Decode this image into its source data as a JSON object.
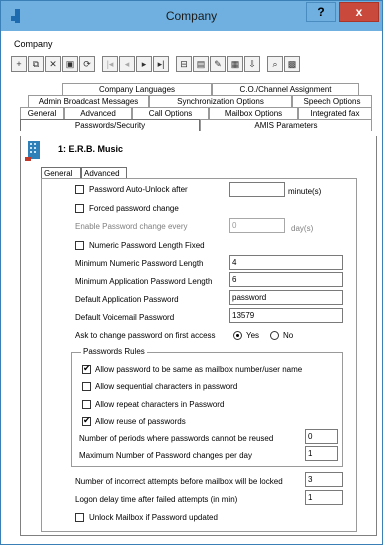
{
  "window": {
    "title": "Company",
    "help_label": "?",
    "close_label": "x"
  },
  "menu": {
    "items": [
      "Company"
    ]
  },
  "toolbar": {
    "buttons": [
      {
        "name": "add",
        "glyph": "+"
      },
      {
        "name": "copy",
        "glyph": "⧉"
      },
      {
        "name": "delete",
        "glyph": "✕"
      },
      {
        "name": "save",
        "glyph": "▣"
      },
      {
        "name": "refresh",
        "glyph": "⟳"
      },
      {
        "name": "first",
        "glyph": "|◂"
      },
      {
        "name": "prev",
        "glyph": "◂"
      },
      {
        "name": "next",
        "glyph": "▸"
      },
      {
        "name": "last",
        "glyph": "▸|"
      },
      {
        "name": "filter",
        "glyph": "⊟"
      },
      {
        "name": "view",
        "glyph": "▤"
      },
      {
        "name": "edit",
        "glyph": "✎"
      },
      {
        "name": "report",
        "glyph": "▦"
      },
      {
        "name": "export",
        "glyph": "⇩"
      },
      {
        "name": "find",
        "glyph": "⌕"
      },
      {
        "name": "print",
        "glyph": "▩"
      }
    ]
  },
  "tabs": {
    "row1": [
      "Company Languages",
      "C.O./Channel Assignment"
    ],
    "row2": [
      "Admin Broadcast Messages",
      "Synchronization Options",
      "Speech Options"
    ],
    "row3": [
      "General",
      "Advanced",
      "Call Options",
      "Mailbox Options",
      "Integrated fax"
    ],
    "row4": [
      "Passwords/Security",
      "AMIS Parameters"
    ]
  },
  "header": {
    "company": "1: E.R.B. Music"
  },
  "subtabs": [
    "General",
    "Advanced"
  ],
  "form": {
    "auto_unlock_label": "Password Auto-Unlock after",
    "auto_unlock_value": "",
    "auto_unlock_unit": "minute(s)",
    "forced_change_label": "Forced password change",
    "enable_change_every_label": "Enable Password change every",
    "enable_change_every_value": "0",
    "enable_change_every_unit": "day(s)",
    "numeric_fixed_label": "Numeric Password Length Fixed",
    "min_numeric_label": "Minimum Numeric Password Length",
    "min_numeric_value": "4",
    "min_app_label": "Minimum Application Password Length",
    "min_app_value": "6",
    "default_app_label": "Default Application Password",
    "default_app_value": "password",
    "default_vm_label": "Default Voicemail Password",
    "default_vm_value": "13579",
    "ask_change_label": "Ask to change password on first access",
    "yes_label": "Yes",
    "no_label": "No",
    "rules_title": "Passwords Rules",
    "rule_same_label": "Allow password to be same as mailbox number/user name",
    "rule_seq_label": "Allow sequential characters in password",
    "rule_repeat_label": "Allow repeat characters in Password",
    "rule_reuse_label": "Allow reuse of passwords",
    "periods_label": "Number of periods where passwords cannot be reused",
    "periods_value": "0",
    "max_changes_label": "Maximum Number of Password changes per day",
    "max_changes_value": "1",
    "incorrect_label": "Number of incorrect attempts before mailbox will be  locked",
    "incorrect_value": "3",
    "delay_label": "Logon delay time after failed attempts (in min)",
    "delay_value": "1",
    "unlock_updated_label": "Unlock Mailbox if Password updated"
  }
}
